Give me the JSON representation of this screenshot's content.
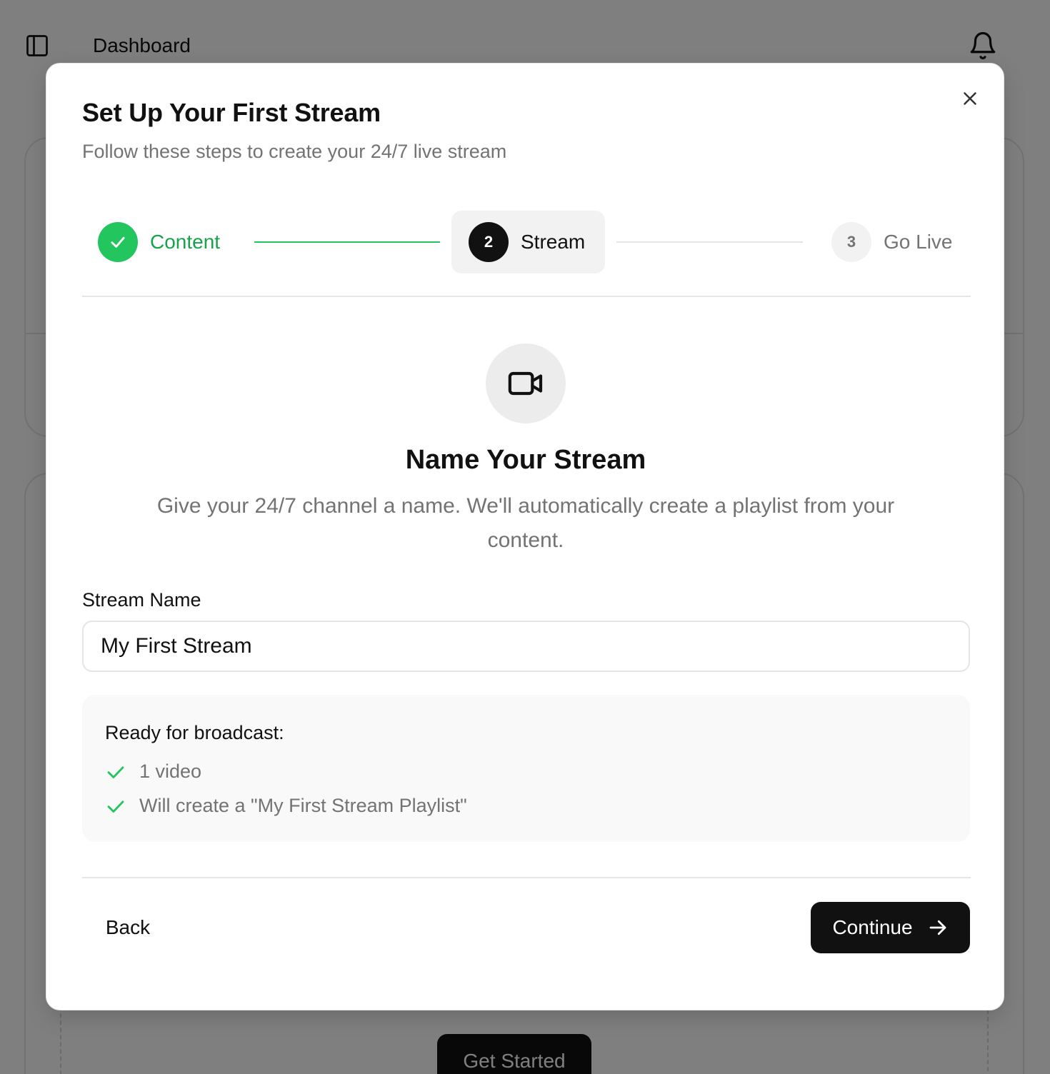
{
  "background": {
    "topbar_title": "Dashboard",
    "get_started_label": "Get Started"
  },
  "modal": {
    "title": "Set Up Your First Stream",
    "subtitle": "Follow these steps to create your 24/7 live stream",
    "steps": [
      {
        "number": "1",
        "label": "Content",
        "state": "completed"
      },
      {
        "number": "2",
        "label": "Stream",
        "state": "active"
      },
      {
        "number": "3",
        "label": "Go Live",
        "state": "upcoming"
      }
    ],
    "section_title": "Name Your Stream",
    "section_description": "Give your 24/7 channel a name. We'll automatically create a playlist from your content.",
    "field": {
      "label": "Stream Name",
      "value": "My First Stream"
    },
    "ready": {
      "title": "Ready for broadcast:",
      "items": [
        "1 video",
        "Will create a \"My First Stream Playlist\""
      ]
    },
    "back_label": "Back",
    "continue_label": "Continue"
  },
  "colors": {
    "accent_green": "#22c55e",
    "primary_dark": "#111111",
    "muted_text": "#737373"
  },
  "icons": [
    "sidebar-toggle-icon",
    "bell-icon",
    "close-icon",
    "check-icon",
    "video-camera-icon",
    "arrow-right-icon"
  ]
}
